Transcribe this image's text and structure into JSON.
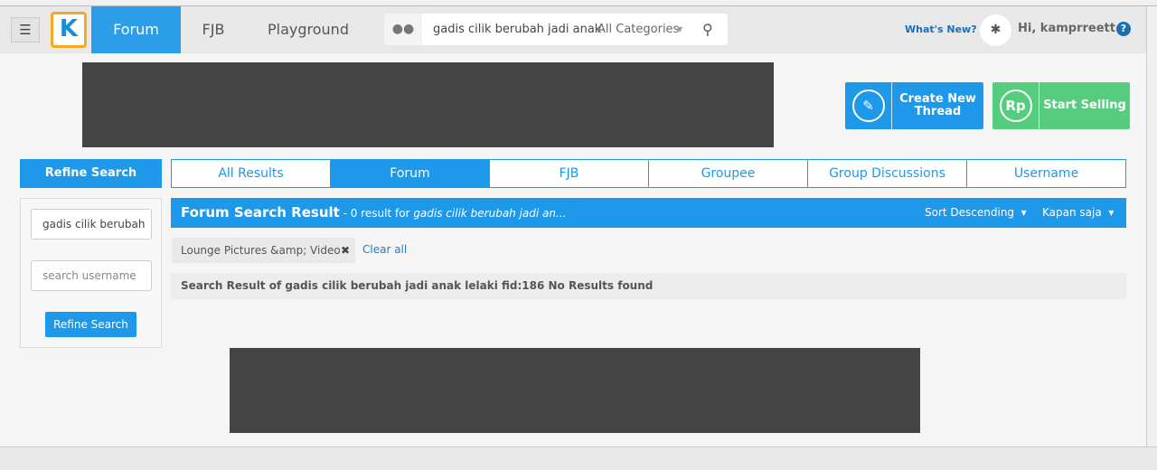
{
  "header": {
    "menu_icon": "hamburger-icon",
    "logo": "K",
    "nav": [
      "Forum",
      "FJB",
      "Playground"
    ],
    "active_nav": "Forum",
    "search": {
      "icon": "chat-cloud-icon",
      "query": "gadis cilik berubah jadi anak",
      "category": "All Categories"
    },
    "whats_new": "What's New?",
    "greeting": "Hi, kamprreett",
    "help": "?"
  },
  "actions": {
    "create_thread": "Create New Thread",
    "start_selling": "Start Selling",
    "rp_icon": "Rp",
    "create_color": "#1e98e8",
    "sell_color": "#56cc7e"
  },
  "refine": {
    "title": "Refine Search",
    "keyword_value": "gadis cilik berubah",
    "username_placeholder": "search username",
    "button": "Refine Search"
  },
  "tabs": [
    "All Results",
    "Forum",
    "FJB",
    "Groupee",
    "Group Discussions",
    "Username"
  ],
  "results": {
    "title": "Forum Search Result",
    "count_text": " - 0 result for ",
    "query": "gadis cilik berubah jadi an...",
    "sort": "Sort Descending",
    "time": "Kapan saja",
    "filter": "Lounge Pictures &amp; Video",
    "clear_all": "Clear all",
    "message": "Search Result of gadis cilik berubah jadi anak lelaki fid:186 No Results found"
  },
  "accent": "#1e98e8"
}
